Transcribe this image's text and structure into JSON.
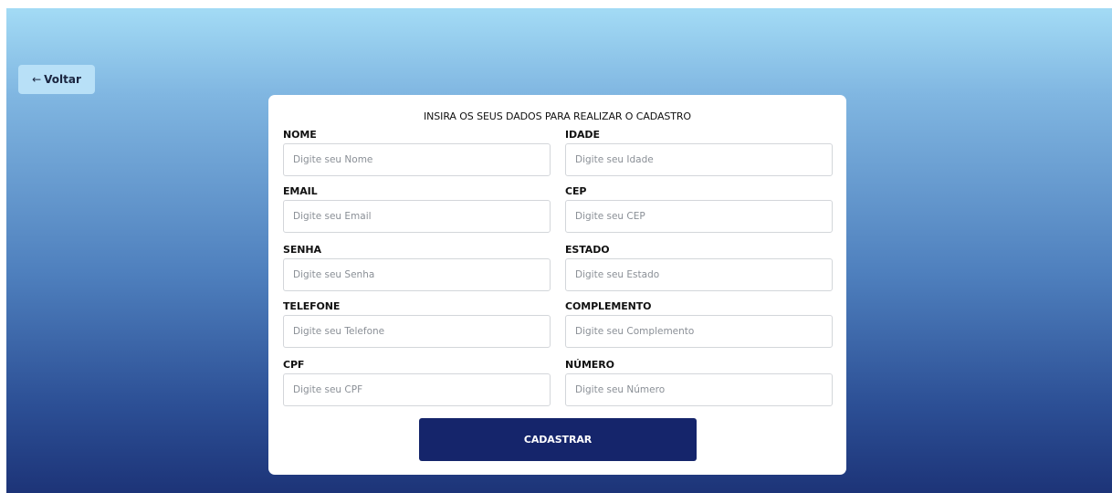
{
  "back_button": {
    "arrow": "←",
    "label": "Voltar"
  },
  "form": {
    "title": "INSIRA OS SEUS DADOS PARA REALIZAR O CADASTRO",
    "fields": {
      "nome": {
        "label": "NOME",
        "placeholder": "Digite seu Nome",
        "value": ""
      },
      "idade": {
        "label": "IDADE",
        "placeholder": "Digite seu Idade",
        "value": ""
      },
      "email": {
        "label": "EMAIL",
        "placeholder": "Digite seu Email",
        "value": ""
      },
      "cep": {
        "label": "CEP",
        "placeholder": "Digite seu CEP",
        "value": ""
      },
      "senha": {
        "label": "SENHA",
        "placeholder": "Digite seu Senha",
        "value": ""
      },
      "estado": {
        "label": "ESTADO",
        "placeholder": "Digite seu Estado",
        "value": ""
      },
      "telefone": {
        "label": "TELEFONE",
        "placeholder": "Digite seu Telefone",
        "value": ""
      },
      "complemento": {
        "label": "COMPLEMENTO",
        "placeholder": "Digite seu Complemento",
        "value": ""
      },
      "cpf": {
        "label": "CPF",
        "placeholder": "Digite seu CPF",
        "value": ""
      },
      "numero": {
        "label": "NÚMERO",
        "placeholder": "Digite seu Número",
        "value": ""
      }
    },
    "submit_label": "CADASTRAR"
  },
  "colors": {
    "gradient_top": "#a3dbf5",
    "gradient_bottom": "#1d3478",
    "back_button_bg": "#b8e0f7",
    "submit_button_bg": "#15256b",
    "card_bg": "#ffffff"
  }
}
